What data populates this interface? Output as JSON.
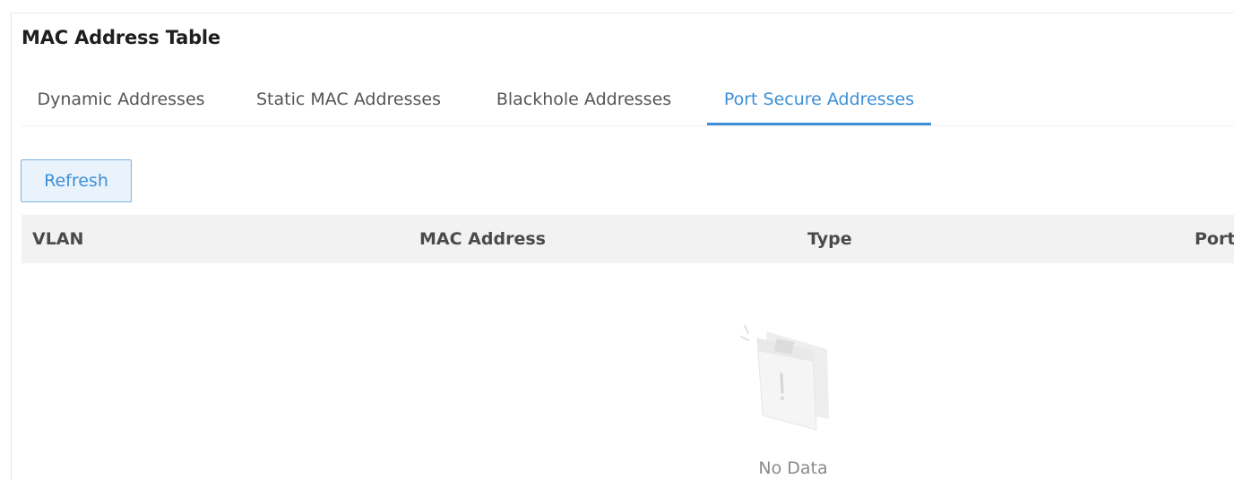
{
  "page": {
    "title": "MAC Address Table"
  },
  "tabs": [
    {
      "label": "Dynamic Addresses",
      "active": false
    },
    {
      "label": "Static MAC Addresses",
      "active": false
    },
    {
      "label": "Blackhole Addresses",
      "active": false
    },
    {
      "label": "Port Secure Addresses",
      "active": true
    }
  ],
  "toolbar": {
    "refresh_label": "Refresh"
  },
  "table": {
    "columns": [
      "VLAN",
      "MAC Address",
      "Type",
      "Port"
    ],
    "rows": [],
    "empty_text": "No Data"
  },
  "colors": {
    "accent": "#3d8fd6",
    "header_bg": "#f2f2f2"
  },
  "icons": {
    "empty_state": "no-data-document-icon"
  }
}
